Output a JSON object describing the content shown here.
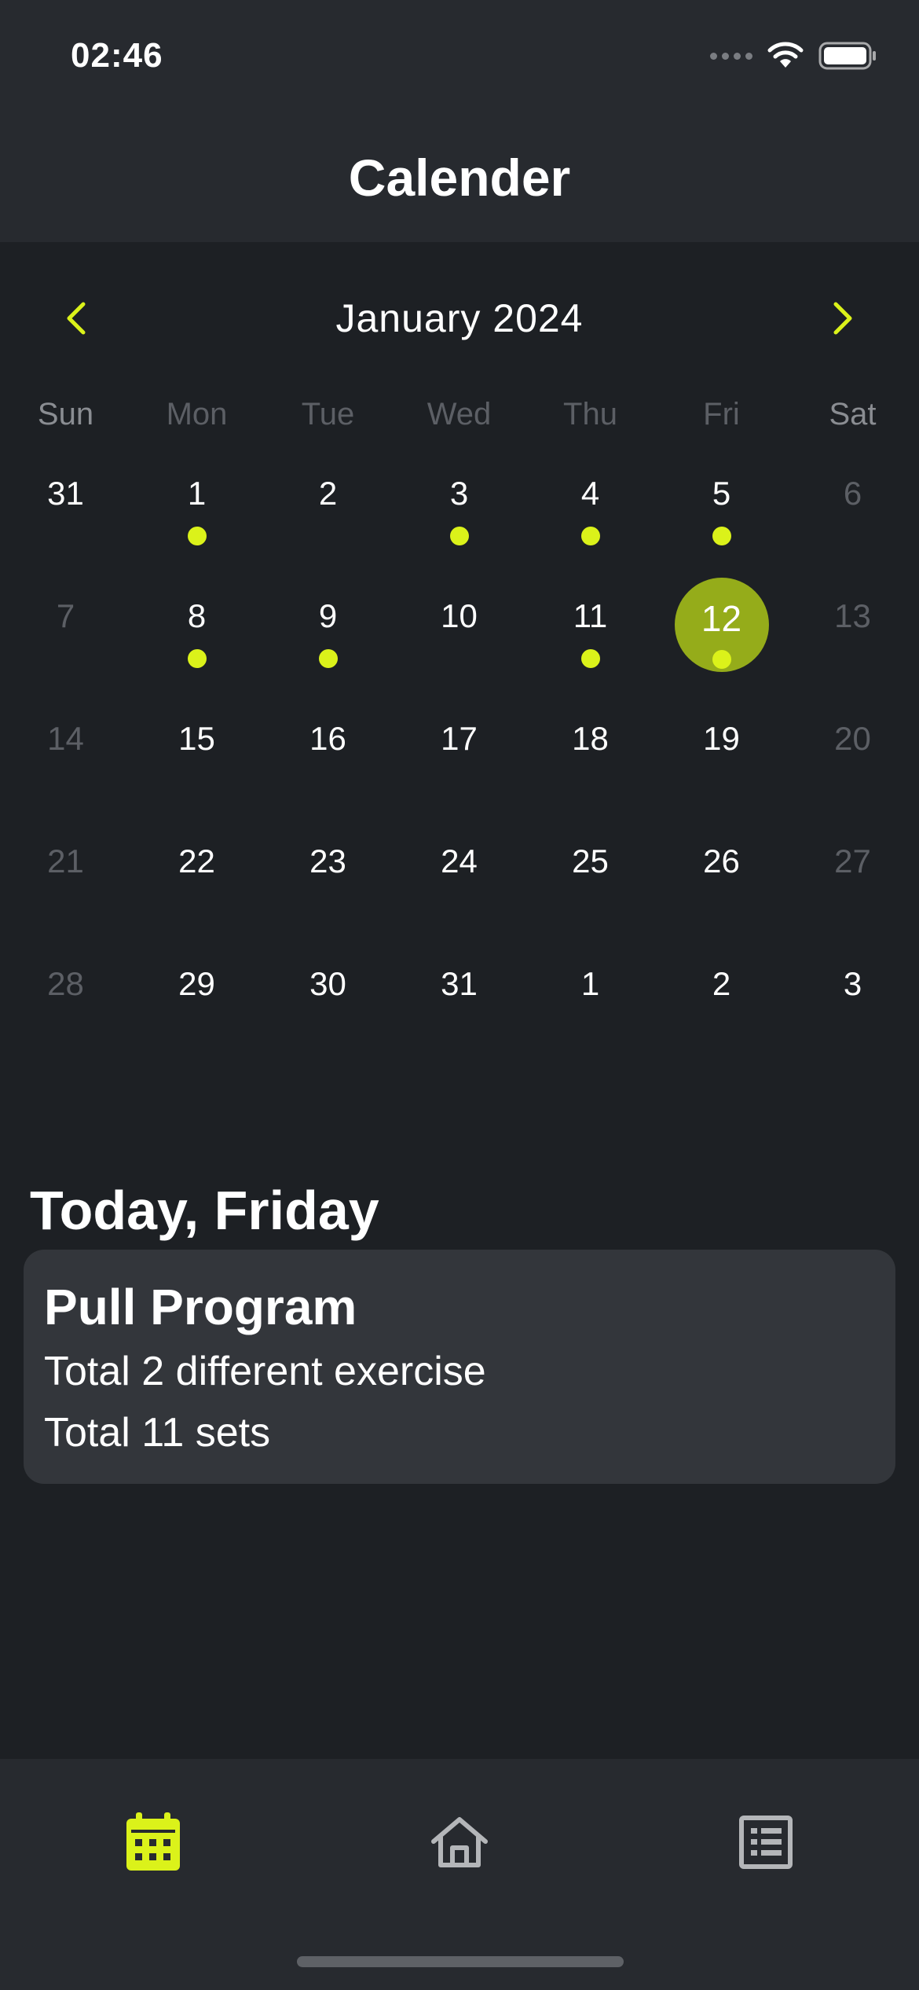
{
  "status_bar": {
    "time": "02:46"
  },
  "header": {
    "title": "Calender"
  },
  "calendar": {
    "month_label": "January 2024",
    "weekdays": [
      "Sun",
      "Mon",
      "Tue",
      "Wed",
      "Thu",
      "Fri",
      "Sat"
    ],
    "weeks": [
      [
        {
          "d": "31",
          "muted": false,
          "dot": false
        },
        {
          "d": "1",
          "muted": false,
          "dot": true
        },
        {
          "d": "2",
          "muted": false,
          "dot": false
        },
        {
          "d": "3",
          "muted": false,
          "dot": true
        },
        {
          "d": "4",
          "muted": false,
          "dot": true
        },
        {
          "d": "5",
          "muted": false,
          "dot": true
        },
        {
          "d": "6",
          "muted": true,
          "dot": false
        }
      ],
      [
        {
          "d": "7",
          "muted": true,
          "dot": false
        },
        {
          "d": "8",
          "muted": false,
          "dot": true
        },
        {
          "d": "9",
          "muted": false,
          "dot": true
        },
        {
          "d": "10",
          "muted": false,
          "dot": false
        },
        {
          "d": "11",
          "muted": false,
          "dot": true
        },
        {
          "d": "12",
          "muted": false,
          "dot": true,
          "selected": true
        },
        {
          "d": "13",
          "muted": true,
          "dot": false
        }
      ],
      [
        {
          "d": "14",
          "muted": true,
          "dot": false
        },
        {
          "d": "15",
          "muted": false,
          "dot": false
        },
        {
          "d": "16",
          "muted": false,
          "dot": false
        },
        {
          "d": "17",
          "muted": false,
          "dot": false
        },
        {
          "d": "18",
          "muted": false,
          "dot": false
        },
        {
          "d": "19",
          "muted": false,
          "dot": false
        },
        {
          "d": "20",
          "muted": true,
          "dot": false
        }
      ],
      [
        {
          "d": "21",
          "muted": true,
          "dot": false
        },
        {
          "d": "22",
          "muted": false,
          "dot": false
        },
        {
          "d": "23",
          "muted": false,
          "dot": false
        },
        {
          "d": "24",
          "muted": false,
          "dot": false
        },
        {
          "d": "25",
          "muted": false,
          "dot": false
        },
        {
          "d": "26",
          "muted": false,
          "dot": false
        },
        {
          "d": "27",
          "muted": true,
          "dot": false
        }
      ],
      [
        {
          "d": "28",
          "muted": true,
          "dot": false
        },
        {
          "d": "29",
          "muted": false,
          "dot": false
        },
        {
          "d": "30",
          "muted": false,
          "dot": false
        },
        {
          "d": "31",
          "muted": false,
          "dot": false
        },
        {
          "d": "1",
          "muted": false,
          "dot": false
        },
        {
          "d": "2",
          "muted": false,
          "dot": false
        },
        {
          "d": "3",
          "muted": false,
          "dot": false
        }
      ]
    ]
  },
  "today": {
    "heading": "Today, Friday",
    "program": {
      "title": "Pull Program",
      "line1": "Total 2 different exercise",
      "line2": "Total 11 sets"
    }
  },
  "tabs": [
    {
      "icon": "calendar-icon",
      "active": true
    },
    {
      "icon": "home-icon",
      "active": false
    },
    {
      "icon": "list-icon",
      "active": false
    }
  ],
  "colors": {
    "accent": "#dbf21a",
    "selected_day": "#95ac1a",
    "background": "#1d2024",
    "surface": "#272a2f",
    "card": "#33363b",
    "muted_text": "#5c5f65",
    "inactive_icon": "#b4b6b9"
  }
}
